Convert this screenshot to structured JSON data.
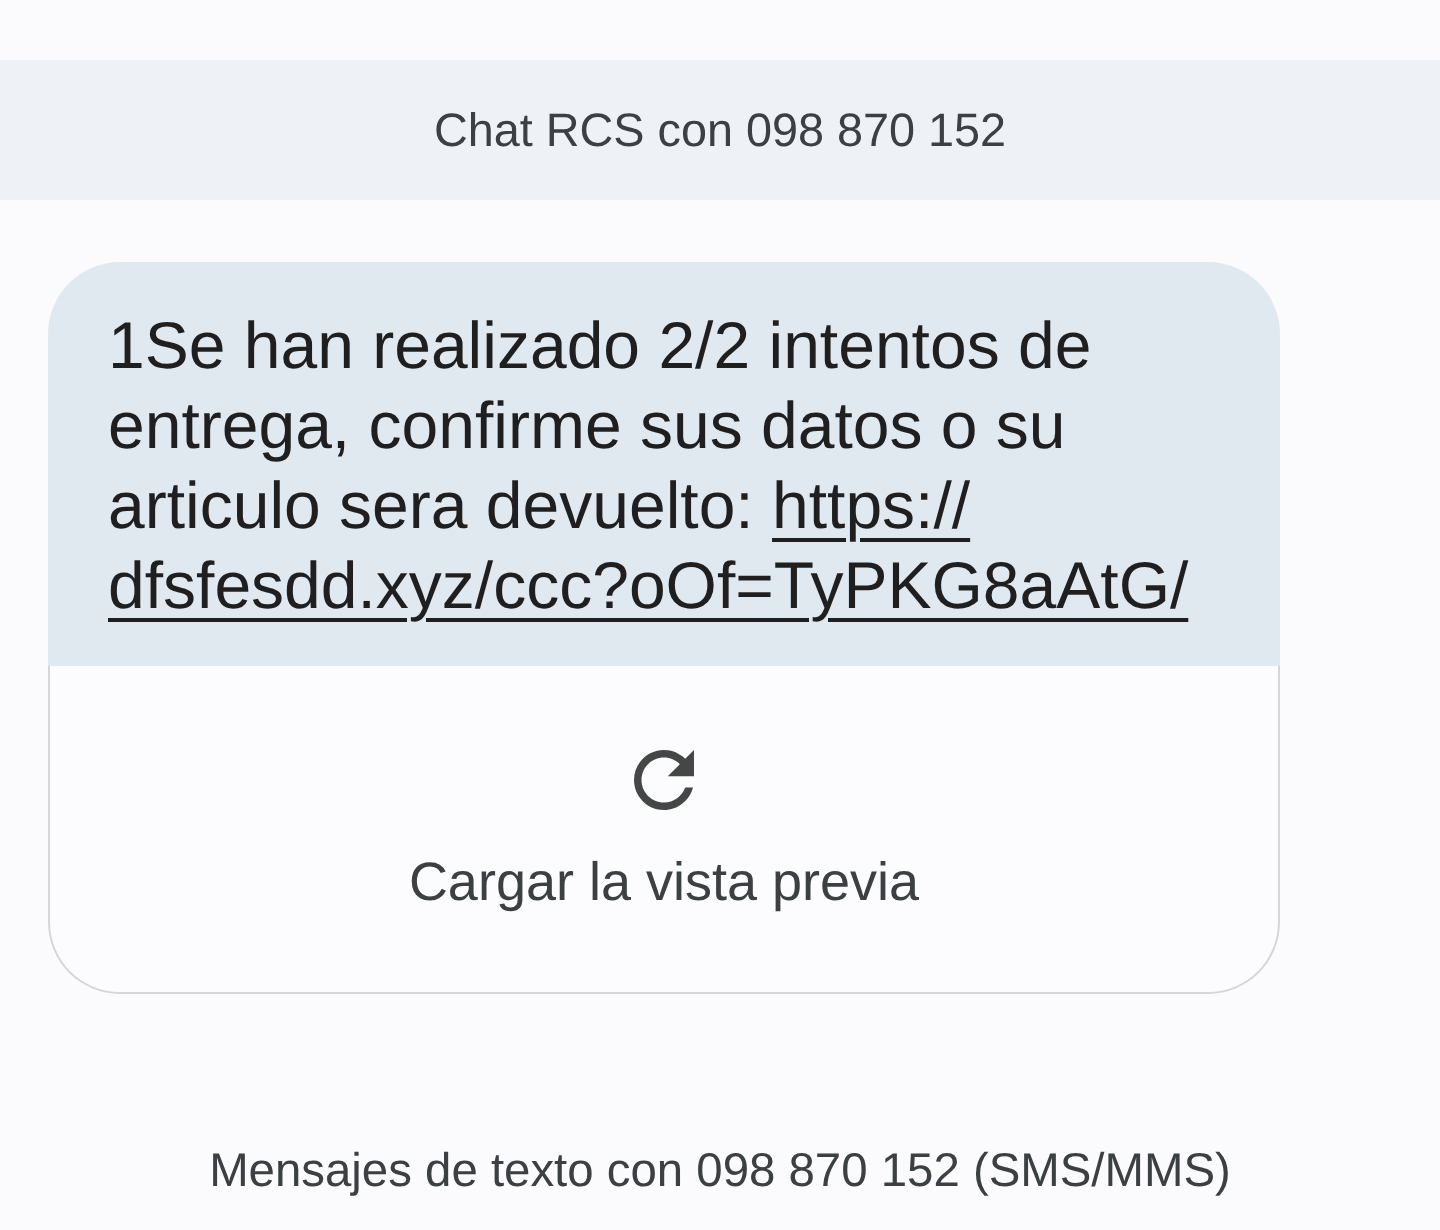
{
  "header": {
    "title": "Chat RCS con 098 870 152"
  },
  "message": {
    "text": "1Se han realizado 2/2 intentos de entrega, confirme sus datos o su articulo sera devuelto:",
    "link_lines": [
      "https://",
      "dfsfesdd.xyz/ccc?oOf=TyPKG8aAtG/"
    ],
    "preview": {
      "label": "Cargar la vista previa"
    }
  },
  "footer": {
    "notice": "Mensajes de texto con 098 870 152 (SMS/MMS)"
  }
}
